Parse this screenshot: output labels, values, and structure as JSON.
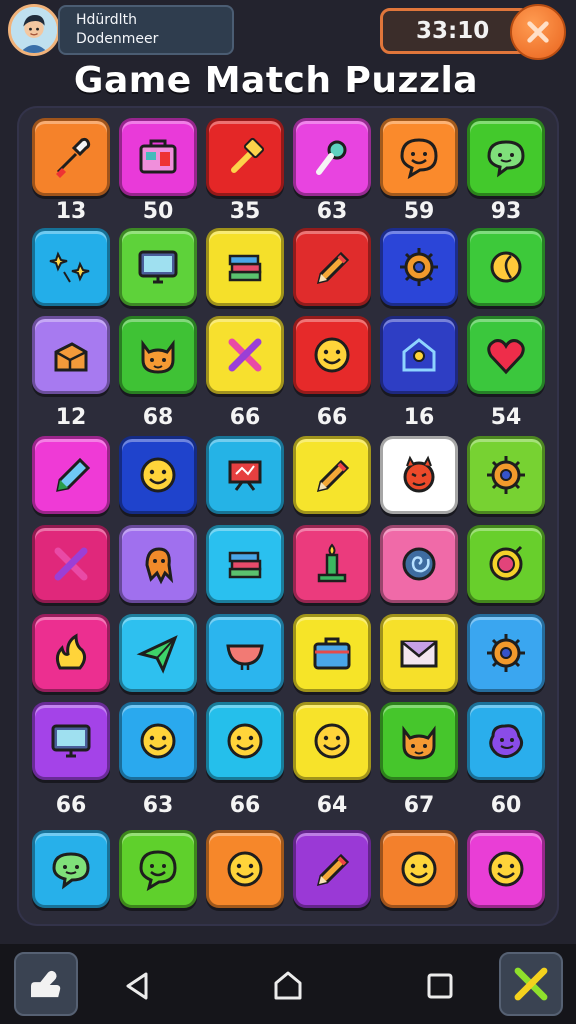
{
  "player": {
    "line1": "Hdürdlth",
    "line2": "Dodenmeer",
    "avatar_icon": "player-avatar"
  },
  "timer": {
    "value": "33:10"
  },
  "close_icon": "close-icon",
  "title": "Game Match Puzzla",
  "score_rows": [
    [
      "13",
      "50",
      "35",
      "63",
      "59",
      "93"
    ],
    [
      "12",
      "68",
      "66",
      "66",
      "16",
      "54"
    ],
    [
      "66",
      "63",
      "66",
      "64",
      "67",
      "60"
    ]
  ],
  "tiles": [
    [
      {
        "color": "#f5822a",
        "icon": "dropper-icon"
      },
      {
        "color": "#e93ad9",
        "icon": "radio-icon"
      },
      {
        "color": "#e42727",
        "icon": "hammer-icon"
      },
      {
        "color": "#e844e0",
        "icon": "microphone-icon"
      },
      {
        "color": "#fa8a2c",
        "icon": "smile-bubble-icon"
      },
      {
        "color": "#43c92c",
        "icon": "chat-bubble-icon"
      }
    ],
    [
      {
        "color": "#23aee9",
        "icon": "sparkles-icon"
      },
      {
        "color": "#5ed23a",
        "icon": "monitor-icon"
      },
      {
        "color": "#f5e02a",
        "icon": "books-icon"
      },
      {
        "color": "#e02c2c",
        "icon": "pencil-icon"
      },
      {
        "color": "#2b45d8",
        "icon": "gear-icon"
      },
      {
        "color": "#3dc93a",
        "icon": "moon-icon"
      }
    ],
    [
      {
        "color": "#a77af0",
        "icon": "box-icon"
      },
      {
        "color": "#3fc235",
        "icon": "cat-icon"
      },
      {
        "color": "#f7e02e",
        "icon": "cross-icon"
      },
      {
        "color": "#e62a2a",
        "icon": "smile-face-icon"
      },
      {
        "color": "#2e3ec4",
        "icon": "house-icon"
      },
      {
        "color": "#3bc73d",
        "icon": "heart-icon"
      }
    ],
    [
      {
        "color": "#ef3ad6",
        "icon": "pen-icon"
      },
      {
        "color": "#1f43cc",
        "icon": "smile-face-icon"
      },
      {
        "color": "#25b3e6",
        "icon": "easel-icon"
      },
      {
        "color": "#f6e42c",
        "icon": "pencil-icon"
      },
      {
        "color": "#ffffff",
        "icon": "devil-icon"
      },
      {
        "color": "#77d232",
        "icon": "gear-icon"
      }
    ],
    [
      {
        "color": "#e0287b",
        "icon": "cross-icon"
      },
      {
        "color": "#a070ee",
        "icon": "octopus-icon"
      },
      {
        "color": "#2ac0ef",
        "icon": "books-icon"
      },
      {
        "color": "#eb3b7d",
        "icon": "candle-icon"
      },
      {
        "color": "#f06aa8",
        "icon": "spiral-icon"
      },
      {
        "color": "#68cf2c",
        "icon": "target-icon"
      }
    ],
    [
      {
        "color": "#ec2f90",
        "icon": "flame-icon"
      },
      {
        "color": "#2ec0ef",
        "icon": "paper-plane-icon"
      },
      {
        "color": "#2bb5ee",
        "icon": "bowl-icon"
      },
      {
        "color": "#f6e428",
        "icon": "briefcase-icon"
      },
      {
        "color": "#f6e02a",
        "icon": "envelope-icon"
      },
      {
        "color": "#3aa6f0",
        "icon": "gear-icon"
      }
    ],
    [
      {
        "color": "#a443e8",
        "icon": "monitor-icon"
      },
      {
        "color": "#2aa9ee",
        "icon": "smile-face-icon"
      },
      {
        "color": "#25bfeb",
        "icon": "smile-face-icon"
      },
      {
        "color": "#f7e32a",
        "icon": "smile-face-icon"
      },
      {
        "color": "#46c62c",
        "icon": "cat-icon"
      },
      {
        "color": "#2aaeec",
        "icon": "blob-icon"
      }
    ],
    [
      {
        "color": "#27b0ea",
        "icon": "chat-bubble-icon"
      },
      {
        "color": "#5fd02c",
        "icon": "smile-bubble-icon"
      },
      {
        "color": "#f6872a",
        "icon": "smile-face-icon"
      },
      {
        "color": "#9a39d6",
        "icon": "pencil-icon"
      },
      {
        "color": "#f3802c",
        "icon": "smile-face-icon"
      },
      {
        "color": "#e93ed6",
        "icon": "smile-face-icon"
      }
    ]
  ],
  "navbar": {
    "left_icon": "hint-hand-icon",
    "back_icon": "nav-back-icon",
    "home_icon": "nav-home-icon",
    "recents_icon": "nav-recents-icon",
    "right_icon": "shuffle-cross-icon"
  }
}
